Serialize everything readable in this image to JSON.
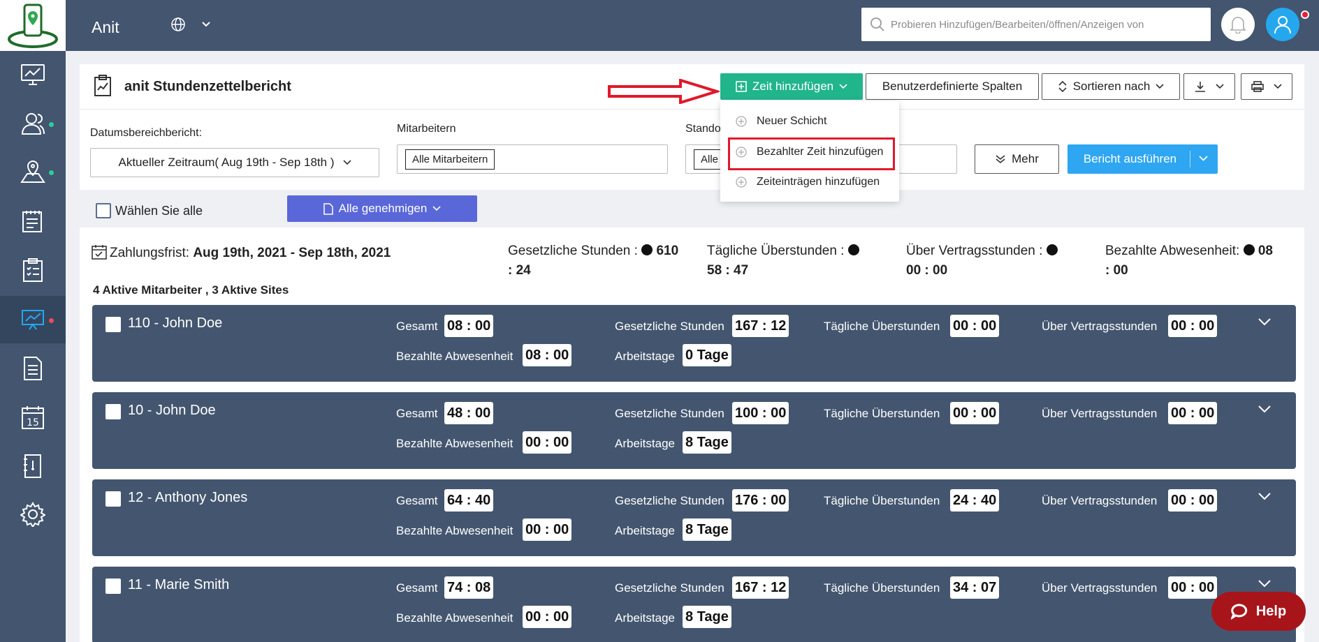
{
  "header": {
    "brand": "Anit",
    "search_placeholder": "Probieren Hinzufügen/Bearbeiten/öffnen/Anzeigen von"
  },
  "colors": {
    "sidebar": "#43556f",
    "green": "#21b58c",
    "blue": "#2ea6f2",
    "purple": "#5a67d8",
    "red": "#e0192b"
  },
  "sidebar": {
    "items": [
      {
        "icon": "dashboard-icon"
      },
      {
        "icon": "users-icon",
        "dot": "#2ecc9a"
      },
      {
        "icon": "map-pin-icon",
        "dot": "#2ecc9a"
      },
      {
        "icon": "schedule-icon"
      },
      {
        "icon": "clipboard-icon"
      },
      {
        "icon": "reports-icon",
        "dot": "#ee4b5a",
        "active": true
      },
      {
        "icon": "document-icon"
      },
      {
        "icon": "calendar-icon"
      },
      {
        "icon": "notebook-icon"
      },
      {
        "icon": "settings-icon"
      }
    ],
    "calendar_day": "15"
  },
  "report": {
    "title": "anit Stundenzettelbericht",
    "add_time_label": "Zeit hinzufügen",
    "custom_columns_label": "Benutzerdefinierte Spalten",
    "sort_label": "Sortieren nach"
  },
  "menu": {
    "items": [
      "Neuer Schicht",
      "Bezahlter Zeit hinzufügen",
      "Zeiteinträgen hinzufügen"
    ]
  },
  "filters": {
    "date_range_label": "Datumsbereichbericht:",
    "date_range_value": "Aktueller Zeitraum( Aug 19th - Sep 18th )",
    "employees_label": "Mitarbeitern",
    "employees_chip": "Alle Mitarbeitern",
    "sites_label": "Stando",
    "sites_chip": "Alle",
    "more_label": "Mehr",
    "run_label": "Bericht ausführen"
  },
  "selection": {
    "select_all_label": "Wählen Sie alle",
    "approve_all_label": "Alle genehmigen"
  },
  "summary": {
    "period_label": "Zahlungsfrist:",
    "period_value": "Aug 19th, 2021 - Sep 18th, 2021",
    "active_line": "4 Aktive Mitarbeiter , 3 Aktive Sites",
    "legal_label": "Gesetzliche Stunden :",
    "legal_value_1": "610",
    "legal_value_2": ": 24",
    "overtime_label": "Tägliche Überstunden :",
    "overtime_value": "58 : 47",
    "contract_label": "Über Vertragsstunden :",
    "contract_value": "00 : 00",
    "paid_label": "Bezahlte Abwesenheit:",
    "paid_value_1": "08",
    "paid_value_2": ": 00"
  },
  "labels": {
    "total": "Gesamt",
    "legal": "Gesetzliche Stunden",
    "daily_ot": "Tägliche Überstunden",
    "contract": "Über Vertragsstunden",
    "paid_absence": "Bezahlte Abwesenheit",
    "workdays": "Arbeitstage"
  },
  "employees": [
    {
      "name": "110 - John Doe",
      "total": "08 : 00",
      "legal": "167 : 12",
      "daily_ot": "00 : 00",
      "contract": "00 : 00",
      "paid_absence": "08 : 00",
      "workdays": "0 Tage"
    },
    {
      "name": "10 - John Doe",
      "total": "48 : 00",
      "legal": "100 : 00",
      "daily_ot": "00 : 00",
      "contract": "00 : 00",
      "paid_absence": "00 : 00",
      "workdays": "8 Tage"
    },
    {
      "name": "12 - Anthony Jones",
      "total": "64 : 40",
      "legal": "176 : 00",
      "daily_ot": "24 : 40",
      "contract": "00 : 00",
      "paid_absence": "00 : 00",
      "workdays": "8 Tage"
    },
    {
      "name": "11 - Marie Smith",
      "total": "74 : 08",
      "legal": "167 : 12",
      "daily_ot": "34 : 07",
      "contract": "00 : 00",
      "paid_absence": "00 : 00",
      "workdays": "8 Tage"
    }
  ],
  "help_label": "Help"
}
